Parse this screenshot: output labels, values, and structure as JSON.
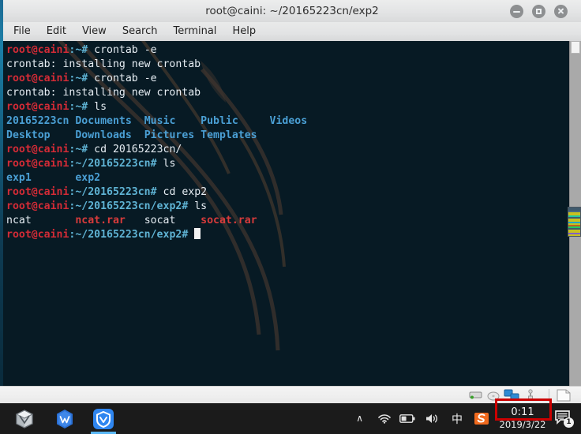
{
  "window": {
    "title": "root@caini: ~/20165223cn/exp2",
    "controls": [
      {
        "name": "minimize-button",
        "label": "–"
      },
      {
        "name": "maximize-button",
        "label": "□"
      },
      {
        "name": "close-button",
        "label": "✕"
      }
    ]
  },
  "menubar": {
    "items": [
      {
        "label": "File"
      },
      {
        "label": "Edit"
      },
      {
        "label": "View"
      },
      {
        "label": "Search"
      },
      {
        "label": "Terminal"
      },
      {
        "label": "Help"
      }
    ]
  },
  "terminal": {
    "prompt_user": "root@caini",
    "lines": [
      {
        "type": "prompt",
        "user": "root@caini",
        "path": ":~#",
        "command": " crontab -e"
      },
      {
        "type": "output",
        "text": "crontab: installing new crontab"
      },
      {
        "type": "prompt",
        "user": "root@caini",
        "path": ":~#",
        "command": " crontab -e"
      },
      {
        "type": "output",
        "text": "crontab: installing new crontab"
      },
      {
        "type": "prompt",
        "user": "root@caini",
        "path": ":~#",
        "command": " ls"
      },
      {
        "type": "listing",
        "items": [
          {
            "text": "20165223cn",
            "color": "dir"
          },
          {
            "text": "Documents",
            "color": "dir"
          },
          {
            "text": "Music",
            "color": "dir"
          },
          {
            "text": "Public",
            "color": "dir"
          },
          {
            "text": "Videos",
            "color": "dir"
          }
        ]
      },
      {
        "type": "listing",
        "items": [
          {
            "text": "Desktop",
            "color": "dir"
          },
          {
            "text": "Downloads",
            "color": "dir"
          },
          {
            "text": "Pictures",
            "color": "dir"
          },
          {
            "text": "Templates",
            "color": "dir"
          }
        ]
      },
      {
        "type": "prompt",
        "user": "root@caini",
        "path": ":~#",
        "command": " cd 20165223cn/"
      },
      {
        "type": "prompt",
        "user": "root@caini",
        "path": ":~/20165223cn#",
        "command": " ls"
      },
      {
        "type": "listing",
        "items": [
          {
            "text": "exp1",
            "color": "dir"
          },
          {
            "text": "exp2",
            "color": "dir"
          }
        ]
      },
      {
        "type": "prompt",
        "user": "root@caini",
        "path": ":~/20165223cn#",
        "command": " cd exp2"
      },
      {
        "type": "prompt",
        "user": "root@caini",
        "path": ":~/20165223cn/exp2#",
        "command": " ls"
      },
      {
        "type": "listing",
        "items": [
          {
            "text": "ncat",
            "color": "file"
          },
          {
            "text": "ncat.rar",
            "color": "arch"
          },
          {
            "text": "socat",
            "color": "file"
          },
          {
            "text": "socat.rar",
            "color": "arch"
          }
        ]
      },
      {
        "type": "prompt",
        "user": "root@caini",
        "path": ":~/20165223cn/exp2#",
        "command": " ",
        "cursor": true
      }
    ],
    "colors": {
      "background": "#071a24",
      "foreground": "#e6edf3",
      "user_host": "#d32b36",
      "path": "#5fb3d4",
      "directory": "#4a9fd4",
      "archive": "#d83b3b"
    }
  },
  "vbox_status": {
    "icons": [
      {
        "name": "hard-disk-icon"
      },
      {
        "name": "optical-disk-icon"
      },
      {
        "name": "network-icon"
      },
      {
        "name": "usb-icon"
      },
      {
        "name": "shared-folder-icon"
      }
    ]
  },
  "taskbar": {
    "apps": [
      {
        "name": "taskbar-virtualbox",
        "label": "VirtualBox"
      },
      {
        "name": "taskbar-wps-office",
        "label": "WPS Office"
      },
      {
        "name": "taskbar-security-app",
        "label": "Security"
      }
    ],
    "tray": [
      {
        "name": "tray-show-hidden-icon",
        "glyph": "∧"
      },
      {
        "name": "tray-wifi-icon",
        "glyph": "wifi"
      },
      {
        "name": "tray-battery-icon",
        "glyph": "battery"
      },
      {
        "name": "tray-volume-icon",
        "glyph": "volume"
      },
      {
        "name": "tray-ime-icon",
        "glyph": "中"
      },
      {
        "name": "tray-sogou-icon",
        "glyph": "S"
      }
    ],
    "clock": {
      "time": "0:11",
      "date": "2019/3/22",
      "highlight_color": "#cc0000"
    },
    "notification": {
      "name": "notification-center-icon",
      "badge": "1"
    }
  }
}
